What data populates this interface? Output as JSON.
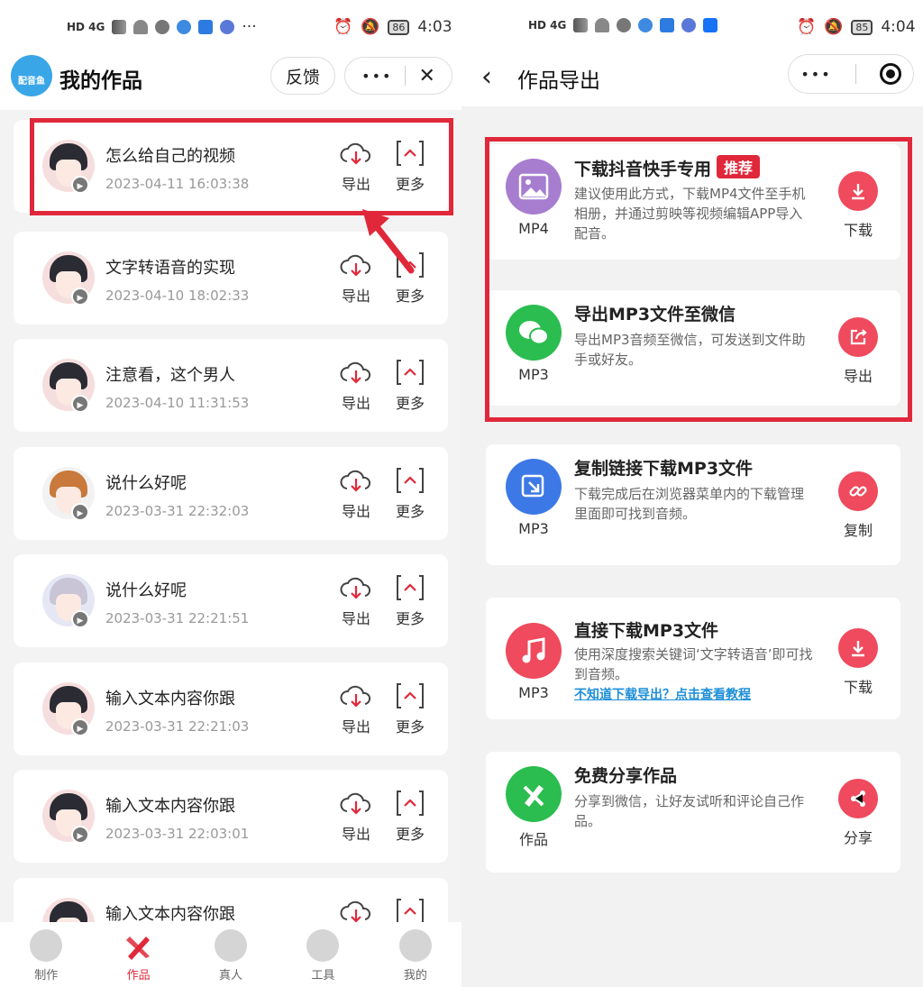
{
  "left": {
    "statusbar": {
      "network": "HD 4G",
      "battery": "86",
      "time": "4:03"
    },
    "header": {
      "logo_text": "配音鱼",
      "title": "我的作品",
      "feedback_label": "反馈",
      "more_label": "•••",
      "close_label": "✕"
    },
    "works": [
      {
        "title": "怎么给自己的视频",
        "date": "2023-04-11 16:03:38",
        "avatar": "dark"
      },
      {
        "title": "文字转语音的实现",
        "date": "2023-04-10 18:02:33",
        "avatar": "dark"
      },
      {
        "title": "注意看，这个男人",
        "date": "2023-04-10 11:31:53",
        "avatar": "dark"
      },
      {
        "title": "说什么好呢",
        "date": "2023-03-31 22:32:03",
        "avatar": "orange"
      },
      {
        "title": "说什么好呢",
        "date": "2023-03-31 22:21:51",
        "avatar": "silver"
      },
      {
        "title": "输入文本内容你跟",
        "date": "2023-03-31 22:21:03",
        "avatar": "dark"
      },
      {
        "title": "输入文本内容你跟",
        "date": "2023-03-31 22:03:01",
        "avatar": "dark"
      },
      {
        "title": "输入文本内容你跟",
        "date": "",
        "avatar": "dark"
      }
    ],
    "actions": {
      "export_label": "导出",
      "more_label": "更多"
    },
    "tabs": [
      {
        "label": "制作",
        "icon": "disc-icon",
        "active": false
      },
      {
        "label": "作品",
        "icon": "pencil-ruler-icon",
        "active": true
      },
      {
        "label": "真人",
        "icon": "person-icon",
        "active": false
      },
      {
        "label": "工具",
        "icon": "toolbox-icon",
        "active": false
      },
      {
        "label": "我的",
        "icon": "gift-icon",
        "active": false
      }
    ],
    "accent_color": "#e0283a"
  },
  "right": {
    "statusbar": {
      "network": "HD 4G",
      "battery": "85",
      "time": "4:04"
    },
    "header": {
      "back_label": "‹",
      "title": "作品导出",
      "more_label": "•••"
    },
    "options": [
      {
        "title": "下载抖音快手专用",
        "badge": "推荐",
        "desc": "建议使用此方式，下载MP4文件至手机相册，并通过剪映等视频编辑APP导入配音。",
        "format": "MP4",
        "icon": "image-icon",
        "icon_color": "#a77dd0",
        "action": "下载",
        "action_icon": "download-icon"
      },
      {
        "title": "导出MP3文件至微信",
        "badge": "",
        "desc": "导出MP3音频至微信，可发送到文件助手或好友。",
        "format": "MP3",
        "icon": "wechat-icon",
        "icon_color": "#2bbd4f",
        "action": "导出",
        "action_icon": "share-out-icon"
      },
      {
        "title": "复制链接下载MP3文件",
        "badge": "",
        "desc": "下载完成后在浏览器菜单内的下载管理里面即可找到音频。",
        "format": "MP3",
        "icon": "link-download-icon",
        "icon_color": "#3d79e6",
        "action": "复制",
        "action_icon": "link-icon"
      },
      {
        "title": "直接下载MP3文件",
        "badge": "",
        "desc": "使用深度搜索关键词‘文字转语音’即可找到音频。",
        "link": "不知道下载导出？点击查看教程",
        "format": "MP3",
        "icon": "music-icon",
        "icon_color": "#ef4a5d",
        "action": "下载",
        "action_icon": "download-icon"
      },
      {
        "title": "免费分享作品",
        "badge": "",
        "desc": "分享到微信，让好友试听和评论自己作品。",
        "format": "作品",
        "icon": "pencil-icon",
        "icon_color": "#2bbd4f",
        "action": "分享",
        "action_icon": "share-icon"
      }
    ]
  }
}
